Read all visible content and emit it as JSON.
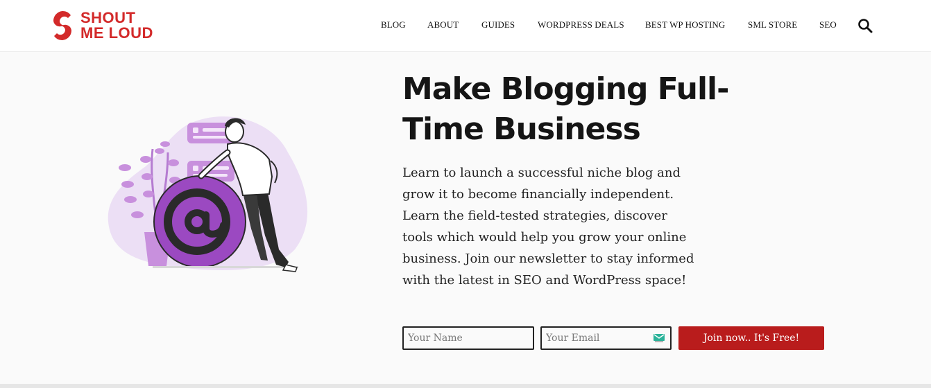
{
  "logo": {
    "line1": "SHOUT",
    "line2": "ME LOUD"
  },
  "nav": {
    "items": [
      {
        "label": "BLOG"
      },
      {
        "label": "ABOUT"
      },
      {
        "label": "GUIDES"
      },
      {
        "label": "WORDPRESS DEALS"
      },
      {
        "label": "BEST WP HOSTING"
      },
      {
        "label": "SML STORE"
      },
      {
        "label": "SEO"
      }
    ],
    "search_icon": "search-icon"
  },
  "hero": {
    "title": "Make Blogging Full-Time Business",
    "description": "Learn to launch a successful niche blog and grow it to become financially independent. Learn the field-tested strategies, discover tools which would help you grow your online business. Join our newsletter to stay informed with the latest in SEO and WordPress space!",
    "illustration_icon": "at-sign-illustration"
  },
  "form": {
    "name_placeholder": "Your Name",
    "email_placeholder": "Your Email",
    "submit_label": "Join now.. It's Free!"
  },
  "colors": {
    "brand_red": "#d32a2a",
    "button_red": "#b91c1c",
    "illustration_purple": "#9b49c1",
    "illustration_light": "#ecdff5"
  }
}
